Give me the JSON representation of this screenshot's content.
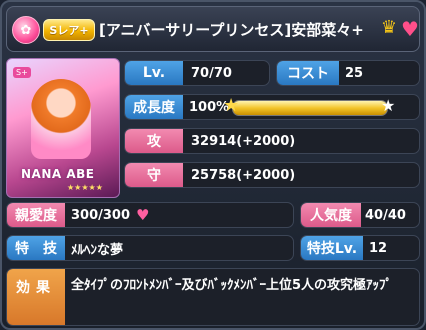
{
  "header": {
    "type_icon": "flower-icon",
    "rarity": "Sレア+",
    "card_name": "[アニバーサリープリンセス]安部菜々+",
    "crown_icon": "crown-icon",
    "heart_icon": "heart-icon"
  },
  "portrait": {
    "badge": "S+",
    "name": "NANA ABE",
    "stars": "★★★★★"
  },
  "stats": {
    "level_label": "Lv.",
    "level_value": "70/70",
    "cost_label": "コスト",
    "cost_value": "25",
    "growth_label": "成長度",
    "growth_value": "100%",
    "growth_percent": 100,
    "attack_label": "攻",
    "attack_value": "32914(+2000)",
    "defense_label": "守",
    "defense_value": "25758(+2000)"
  },
  "info": {
    "affection_label": "親愛度",
    "affection_value": "300/300",
    "popularity_label": "人気度",
    "popularity_value": "40/40",
    "skill_label": "特　技",
    "skill_value": "ﾒﾙﾍﾝな夢",
    "skill_level_label": "特技Lv.",
    "skill_level_value": "12",
    "effect_label": "効果",
    "effect_value": "全ﾀｲﾌﾟのﾌﾛﾝﾄﾒﾝﾊﾞｰ及びﾊﾞｯｸﾒﾝﾊﾞｰ上位5人の攻究極ｱｯﾌﾟ"
  },
  "colors": {
    "blue_tag": "#2a78c2",
    "pink_tag": "#dc5a8a",
    "orange_tag": "#d8782a",
    "gold": "#f3c52a"
  }
}
